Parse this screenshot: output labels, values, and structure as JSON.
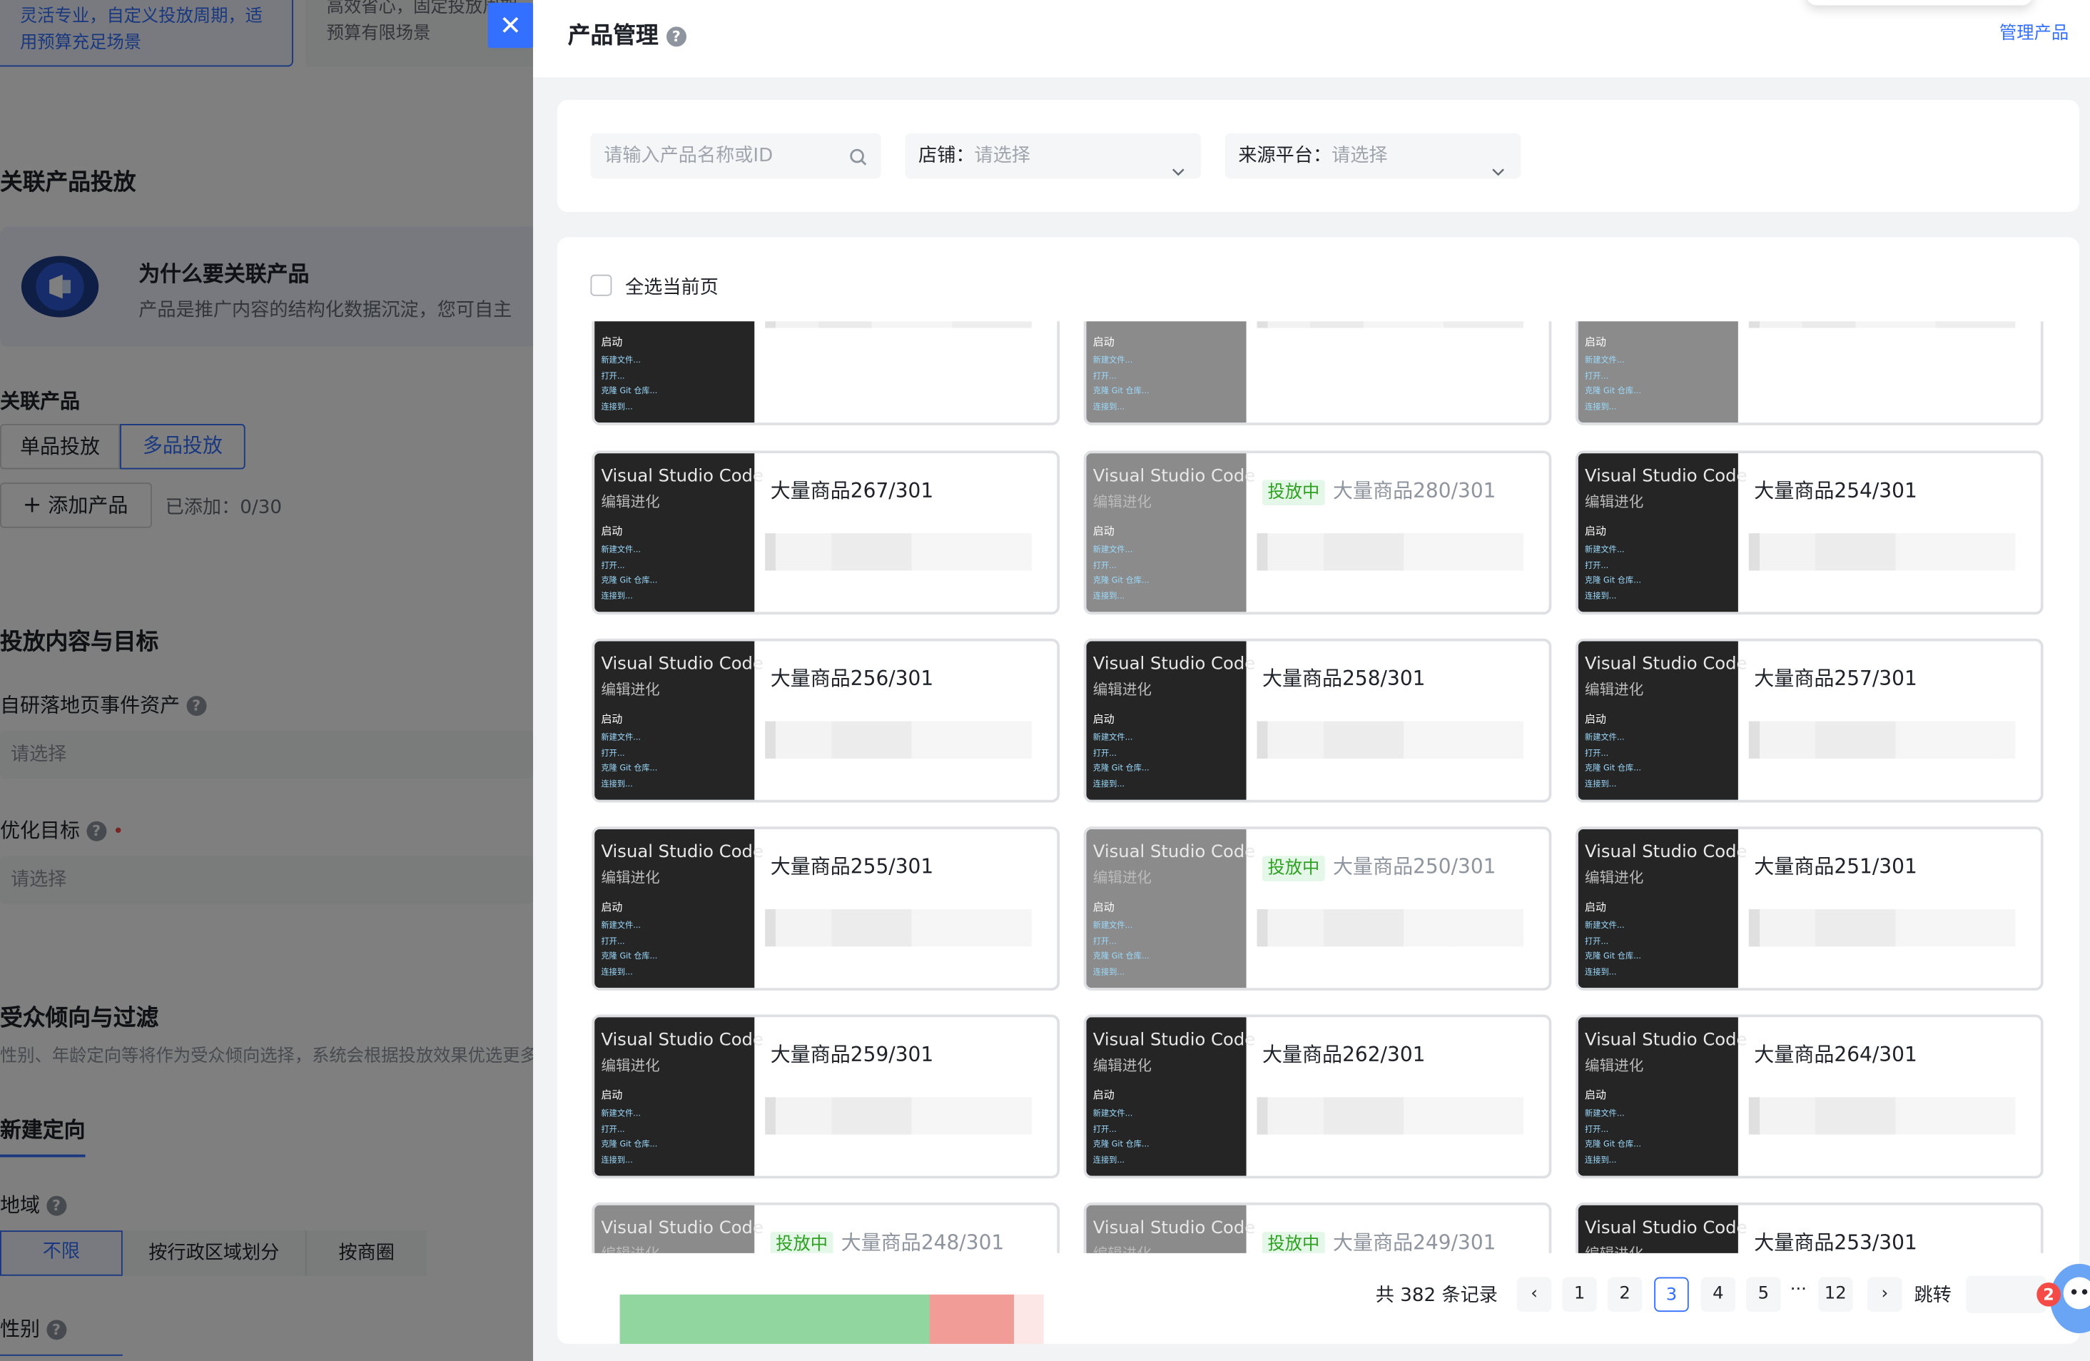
{
  "background_form": {
    "option_active_text": [
      "灵活专业，自定义投放周期，适",
      "用预算充足场景"
    ],
    "option_inactive_text": [
      "高效省心，固定投放周期，",
      "预算有限场景"
    ],
    "section_related_product": "关联产品投放",
    "why_title": "为什么要关联产品",
    "why_desc": "产品是推广内容的结构化数据沉淀，您可自主",
    "related_product_label": "关联产品",
    "single_tab": "单品投放",
    "multi_tab": "多品投放",
    "add_product_button": "添加产品",
    "added_count": "已添加：0/30",
    "section_content_goal": "投放内容与目标",
    "landing_event_label": "自研落地页事件资产",
    "landing_event_placeholder": "请选择",
    "optimize_goal_label": "优化目标",
    "optimize_goal_placeholder": "请选择",
    "section_audience": "受众倾向与过滤",
    "audience_desc": "性别、年龄定向等将作为受众倾向选择，系统会根据投放效果优选更多人",
    "new_targeting_tab": "新建定向",
    "region_label": "地域",
    "region_options": [
      "不限",
      "按行政区域划分",
      "按商圈"
    ],
    "gender_label": "性别"
  },
  "drawer": {
    "close_icon": "close-icon",
    "title": "产品管理",
    "manage_link": "管理产品",
    "search_placeholder": "请输入产品名称或ID",
    "shop_label": "店铺：",
    "shop_placeholder": "请选择",
    "platform_label": "来源平台：",
    "platform_placeholder": "请选择",
    "select_all_label": "全选当前页",
    "thumb_title": "Visual Studio Code",
    "thumb_subtitle": "编辑进化",
    "thumb_start": "启动",
    "thumb_menu": [
      "新建文件...",
      "打开...",
      "克隆 Git 仓库...",
      "连接到..."
    ],
    "status_tag": "投放中",
    "rows": [
      [
        {
          "name": "",
          "active": false,
          "dim": false
        },
        {
          "name": "",
          "active": false,
          "dim": true
        },
        {
          "name": "",
          "active": false,
          "dim": true
        }
      ],
      [
        {
          "name": "大量商品267/301",
          "active": false,
          "dim": false
        },
        {
          "name": "大量商品280/301",
          "active": true,
          "dim": true
        },
        {
          "name": "大量商品254/301",
          "active": false,
          "dim": false
        }
      ],
      [
        {
          "name": "大量商品256/301",
          "active": false,
          "dim": false
        },
        {
          "name": "大量商品258/301",
          "active": false,
          "dim": false
        },
        {
          "name": "大量商品257/301",
          "active": false,
          "dim": false
        }
      ],
      [
        {
          "name": "大量商品255/301",
          "active": false,
          "dim": false
        },
        {
          "name": "大量商品250/301",
          "active": true,
          "dim": true
        },
        {
          "name": "大量商品251/301",
          "active": false,
          "dim": false
        }
      ],
      [
        {
          "name": "大量商品259/301",
          "active": false,
          "dim": false
        },
        {
          "name": "大量商品262/301",
          "active": false,
          "dim": false
        },
        {
          "name": "大量商品264/301",
          "active": false,
          "dim": false
        }
      ],
      [
        {
          "name": "大量商品248/301",
          "active": true,
          "dim": true
        },
        {
          "name": "大量商品249/301",
          "active": true,
          "dim": true
        },
        {
          "name": "大量商品253/301",
          "active": false,
          "dim": false
        }
      ]
    ],
    "pagination": {
      "total": "共 382 条记录",
      "pages": [
        "1",
        "2",
        "3",
        "4",
        "5",
        "12"
      ],
      "current": "3",
      "ellipsis": "···",
      "jump_label": "跳转"
    },
    "assistant_badge": "2"
  }
}
